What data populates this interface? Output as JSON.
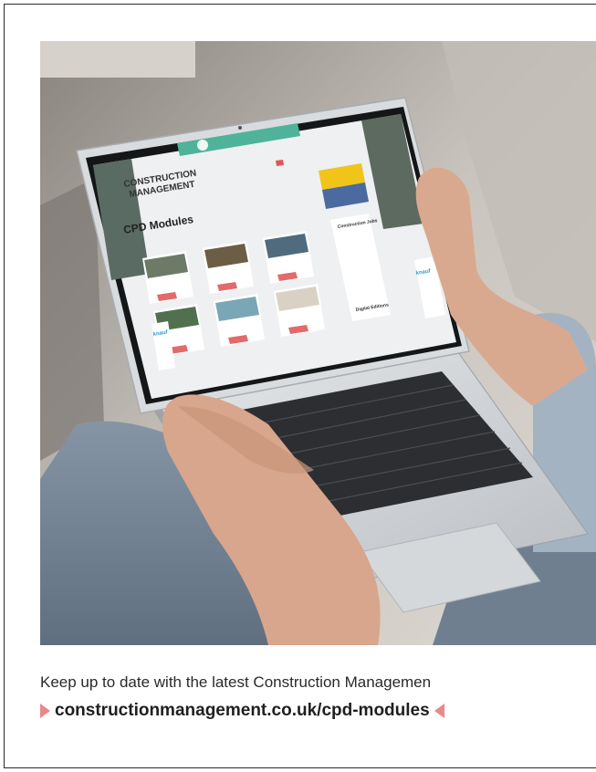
{
  "colors": {
    "accent": "#e9898a",
    "screen_header_teal": "#4fb39a",
    "ad_yellow": "#f0c419",
    "button_red": "#e25555"
  },
  "screen": {
    "logo_line1": "CONSTRUCTION",
    "logo_line2": "MANAGEMENT",
    "page_title": "CPD Modules",
    "sidebar_heading": "Construction Jobs",
    "digital_editions": "Digital Editions",
    "ad_brand": "knauf"
  },
  "caption": {
    "text": "Keep up to date with the latest Construction Managemen",
    "url": "constructionmanagement.co.uk/cpd-modules"
  }
}
